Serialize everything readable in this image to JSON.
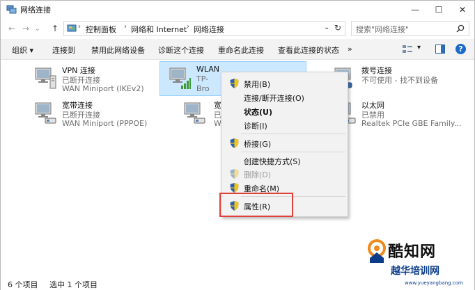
{
  "window": {
    "title": "网络连接",
    "controls": {
      "minimize": "—",
      "maximize": "☐",
      "close": "✕"
    }
  },
  "nav": {
    "back_icon": "←",
    "forward_icon": "→",
    "dropdown_icon": "⌄",
    "up_icon": "↑",
    "breadcrumb": [
      "控制面板",
      "网络和 Internet",
      "网络连接"
    ],
    "separator": "›",
    "refresh_icon": "↻",
    "search_placeholder": "搜索\"网络连接\""
  },
  "toolbar": {
    "items": [
      "组织 ▾",
      "连接到",
      "禁用此网络设备",
      "诊断这个连接",
      "重命名此连接",
      "查看此连接的状态",
      "»"
    ],
    "view_dropdown": "▾",
    "help": "?"
  },
  "connections": [
    {
      "name": "VPN 连接",
      "status": "已断开连接",
      "device": "WAN Miniport (IKEv2)"
    },
    {
      "name": "WLAN",
      "status": "TP-",
      "device": "Bro"
    },
    {
      "name": "拨号连接",
      "status": "不可使用 - 找不到设备",
      "device": ""
    },
    {
      "name": "宽带连接",
      "status": "已断开连接",
      "device": "WAN Miniport (PPPOE)"
    },
    {
      "name": "宽带",
      "status": "已断",
      "device": "WA"
    },
    {
      "name": "以太网",
      "status": "已禁用",
      "device": "Realtek PCIe GBE Family..."
    }
  ],
  "context_menu": {
    "items": [
      {
        "label": "禁用(B)",
        "shield": true,
        "bold": false,
        "disabled": false
      },
      {
        "label": "连接/断开连接(O)",
        "shield": false,
        "bold": false,
        "disabled": false
      },
      {
        "label": "状态(U)",
        "shield": false,
        "bold": true,
        "disabled": false
      },
      {
        "label": "诊断(I)",
        "shield": false,
        "bold": false,
        "disabled": false
      },
      {
        "label": "桥接(G)",
        "shield": true,
        "bold": false,
        "disabled": false
      },
      {
        "label": "创建快捷方式(S)",
        "shield": false,
        "bold": false,
        "disabled": false
      },
      {
        "label": "删除(D)",
        "shield": true,
        "bold": false,
        "disabled": true
      },
      {
        "label": "重命名(M)",
        "shield": true,
        "bold": false,
        "disabled": false
      },
      {
        "label": "属性(R)",
        "shield": true,
        "bold": false,
        "disabled": false
      }
    ]
  },
  "statusbar": {
    "count": "6 个项目",
    "selected": "选中 1 个项目"
  },
  "watermark": {
    "title": "酷知网",
    "subtitle": "越华培训网",
    "url": "www.yueyangbang.com"
  },
  "colors": {
    "selection_bg": "#cce8ff",
    "highlight_border": "#e0403a",
    "watermark_blue": "#0b3c8c"
  }
}
